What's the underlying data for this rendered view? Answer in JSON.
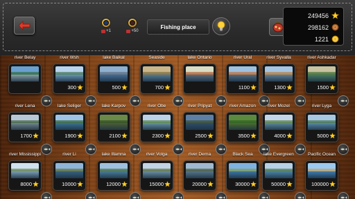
{
  "header": {
    "title": "Fishing place",
    "tokens": [
      {
        "count": "+1"
      },
      {
        "count": "+50"
      }
    ]
  },
  "currency": {
    "stars": "249456",
    "bronze": "298162",
    "gold": "1221"
  },
  "locations": [
    {
      "name": "river Belay",
      "price": "",
      "colors": [
        "#6aa0d0",
        "#2f6b3b",
        "#9ab"
      ]
    },
    {
      "name": "river Wsh",
      "price": "300",
      "colors": [
        "#b9d4ee",
        "#3d6e4b",
        "#6f9cc8"
      ]
    },
    {
      "name": "lake Baikal",
      "price": "500",
      "colors": [
        "#8fb0cf",
        "#5d6c7b",
        "#3f6d9a"
      ]
    },
    {
      "name": "Seaside",
      "price": "700",
      "colors": [
        "#c9b68a",
        "#7a6a3a",
        "#4d7fa6"
      ]
    },
    {
      "name": "lake Ontario",
      "price": "",
      "colors": [
        "#d9ddc5",
        "#b45a2a",
        "#476f8a"
      ]
    },
    {
      "name": "river Ural",
      "price": "1100",
      "colors": [
        "#9ec1e0",
        "#c46b2d",
        "#3c6b8d"
      ]
    },
    {
      "name": "river Syvalla",
      "price": "1300",
      "colors": [
        "#a6c5e3",
        "#bb7b33",
        "#4e7fa8"
      ]
    },
    {
      "name": "river Ashkadar",
      "price": "1500",
      "colors": [
        "#c7c2a0",
        "#3e6a32",
        "#4a7d6a"
      ]
    },
    {
      "name": "river Lena",
      "price": "1700",
      "colors": [
        "#b8c7d6",
        "#3a5e3a",
        "#7a8e9a"
      ]
    },
    {
      "name": "lake Seliger",
      "price": "1900",
      "colors": [
        "#9fc3e6",
        "#2e5e2e",
        "#3d76a5"
      ]
    },
    {
      "name": "lake Karpov",
      "price": "2100",
      "colors": [
        "#6b8a4a",
        "#2f4a22",
        "#51633a"
      ]
    },
    {
      "name": "river Obe",
      "price": "2300",
      "colors": [
        "#bcd2e8",
        "#4c7d3a",
        "#6a96b8"
      ]
    },
    {
      "name": "river Pripyat",
      "price": "2500",
      "colors": [
        "#5d7fa6",
        "#3a4c2e",
        "#2c4e72"
      ]
    },
    {
      "name": "river Amazon",
      "price": "3500",
      "colors": [
        "#5a8a3e",
        "#2d5f22",
        "#4f7030"
      ]
    },
    {
      "name": "river Mozel",
      "price": "4000",
      "colors": [
        "#c3d6e9",
        "#4f7a39",
        "#5e8bb0"
      ]
    },
    {
      "name": "river Lyga",
      "price": "5000",
      "colors": [
        "#a8c7e1",
        "#3f6e44",
        "#5b8fba"
      ]
    },
    {
      "name": "river Mississippi",
      "price": "8000",
      "colors": [
        "#cfe0ef",
        "#5c7d4a",
        "#7fa5c6"
      ]
    },
    {
      "name": "river Li",
      "price": "10000",
      "colors": [
        "#8fb5d9",
        "#5a6e3a",
        "#2f5f8a"
      ]
    },
    {
      "name": "lake Illamna",
      "price": "12000",
      "colors": [
        "#9fc1df",
        "#3e6b3e",
        "#4a7fa8"
      ]
    },
    {
      "name": "river Volga",
      "price": "15000",
      "colors": [
        "#c2d4e5",
        "#506a3a",
        "#6f95b4"
      ]
    },
    {
      "name": "river Derna",
      "price": "20000",
      "colors": [
        "#a0b9cf",
        "#3d5236",
        "#5b7c98"
      ]
    },
    {
      "name": "Black Sea",
      "price": "30000",
      "colors": [
        "#7fb2e0",
        "#7a9a5a",
        "#2f6fae"
      ]
    },
    {
      "name": "lake Evergreen",
      "price": "50000",
      "colors": [
        "#b7d0e6",
        "#3f6f45",
        "#4d86b5"
      ]
    },
    {
      "name": "Pacific Ocean",
      "price": "100000",
      "colors": [
        "#9cc9ef",
        "#b9a26a",
        "#2a73b8"
      ]
    }
  ]
}
